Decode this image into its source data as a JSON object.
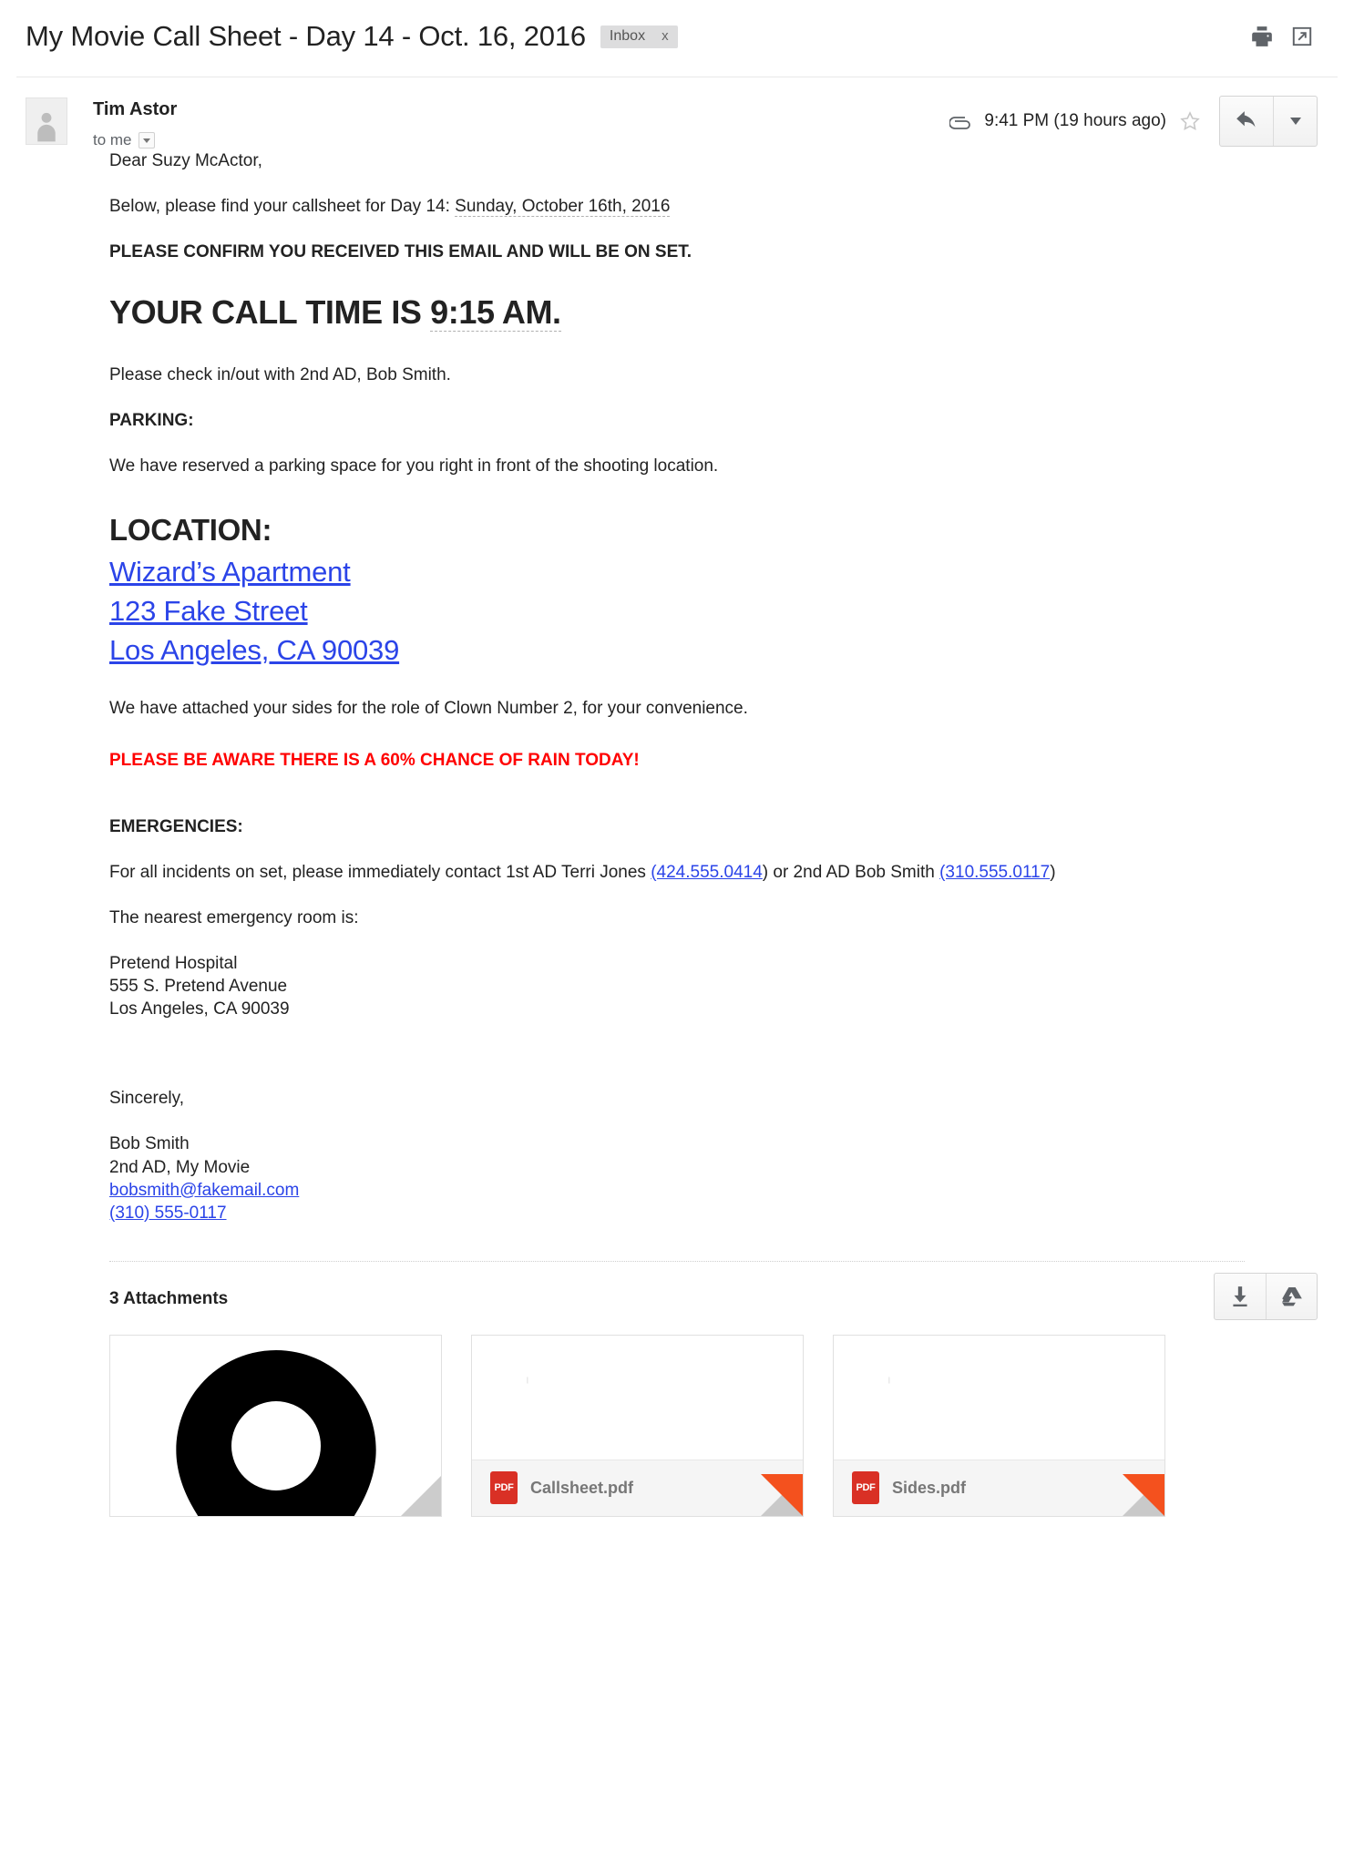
{
  "header": {
    "subject": "My Movie Call Sheet - Day 14 - Oct. 16, 2016",
    "label_chip": "Inbox",
    "label_chip_close": "x",
    "print_icon": "printer-icon",
    "popout_icon": "open-in-new-window-icon"
  },
  "message": {
    "sender_name": "Tim Astor",
    "recipient_line": "to me",
    "timestamp": "9:41 PM (19 hours ago)",
    "attachment_icon": "paperclip-icon",
    "star_icon": "star-outline-icon",
    "reply_icon": "reply-arrow-icon",
    "more_icon": "chevron-down-icon",
    "avatar_icon": "user-avatar-icon",
    "recipient_caret_icon": "chevron-down-icon"
  },
  "body": {
    "greeting": "Dear Suzy McActor,",
    "intro_prefix": "Below, please find your callsheet for Day 14: ",
    "intro_date": "Sunday, October 16th, 2016",
    "confirm_line": "PLEASE CONFIRM YOU RECEIVED THIS EMAIL AND WILL BE ON SET.",
    "call_time_prefix": "YOUR CALL TIME IS ",
    "call_time_value": "9:15 AM.",
    "checkin_line": "Please check in/out with 2nd AD, Bob Smith.",
    "parking_heading": "PARKING:",
    "parking_text": "We have reserved a parking space for you right in front of the shooting location.",
    "location_heading": "LOCATION:",
    "location_lines": [
      "Wizard’s Apartment",
      "123 Fake Street",
      "Los Angeles, CA 90039"
    ],
    "sides_line": "We have attached your sides for the role of Clown Number 2, for your convenience.",
    "rain_warning": "PLEASE BE AWARE THERE IS A 60% CHANCE OF RAIN TODAY!",
    "emergencies_heading": "EMERGENCIES:",
    "emergency_text_1": "For all incidents on set, please immediately contact 1st AD Terri Jones ",
    "emergency_phone_1": "(424.555.0414",
    "emergency_text_2": ") or 2nd AD Bob Smith ",
    "emergency_phone_2": "(310.555.0117",
    "emergency_text_3": ")",
    "er_line": "The nearest emergency room is:",
    "hospital_name": "Pretend Hospital",
    "hospital_street": "555 S. Pretend Avenue",
    "hospital_city": "Los Angeles, CA 90039",
    "signoff": "Sincerely,",
    "sig_name": "Bob Smith",
    "sig_title": "2nd AD, My Movie",
    "sig_email": "bobsmith@fakemail.com",
    "sig_phone": "(310) 555-0117"
  },
  "attachments": {
    "title": "3 Attachments",
    "download_icon": "download-arrow-icon",
    "drive_icon": "google-drive-icon",
    "items": [
      {
        "name": "",
        "type": "image",
        "thumb_icon": "map-pin-icon"
      },
      {
        "name": "Callsheet.pdf",
        "type": "pdf",
        "badge": "PDF"
      },
      {
        "name": "Sides.pdf",
        "type": "pdf",
        "badge": "PDF"
      }
    ]
  },
  "colors": {
    "link_blue": "#2b44e8",
    "warning_red": "#ff0000",
    "pdf_red": "#d93025",
    "fold_orange": "#f4511e",
    "text": "#222222"
  }
}
